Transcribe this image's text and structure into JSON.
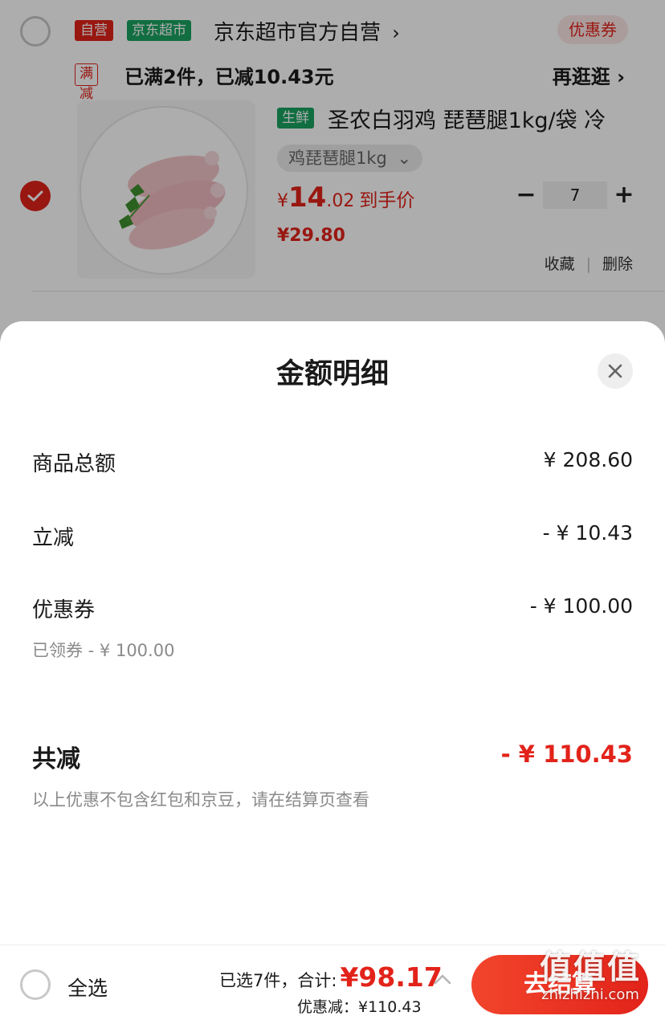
{
  "shop": {
    "tag_self": "自营",
    "tag_super": "京东超市",
    "name": "京东超市官方自营",
    "name_arrow": "›",
    "coupon_label": "优惠券",
    "promo_tag": "满减",
    "promo_text": "已满2件，已减10.43元",
    "more_label": "再逛逛",
    "more_arrow": "›"
  },
  "item": {
    "fresh_tag": "生鲜",
    "title": "圣农白羽鸡 琵琶腿1kg/袋 冷",
    "spec": "鸡琵琶腿1kg",
    "spec_arrow": "⌄",
    "price_yen": "¥",
    "price_int": "14",
    "price_dec": ".02",
    "price_label": "到手价",
    "original_price": "¥29.80",
    "minus": "−",
    "plus": "+",
    "quantity": "7",
    "favorite_label": "收藏",
    "action_sep": "|",
    "delete_label": "删除",
    "checked": true
  },
  "sheet": {
    "title": "金额明细",
    "rows": [
      {
        "label": "商品总额",
        "value": "¥ 208.60"
      },
      {
        "label": "立减",
        "value": "- ¥ 10.43"
      },
      {
        "label": "优惠券",
        "value": "- ¥ 100.00"
      }
    ],
    "coupon_note": "已领券 - ¥ 100.00",
    "total_label": "共减",
    "total_value": "- ¥ 110.43",
    "total_note": "以上优惠不包含红包和京豆，请在结算页查看"
  },
  "bottom": {
    "select_all": "全选",
    "summary_prefix": "已选7件，合计:",
    "summary_amount": "¥98.17",
    "discount_line": "优惠减：¥110.43",
    "checkout": "去结算"
  },
  "watermark": {
    "logo": "值值值",
    "url": "zhizhizhi.com"
  },
  "colors": {
    "accent": "#e2231a",
    "green": "#1aa260"
  },
  "icons": {
    "close": "close-icon",
    "check": "check-icon",
    "chevron_up": "chevron-up-icon"
  }
}
